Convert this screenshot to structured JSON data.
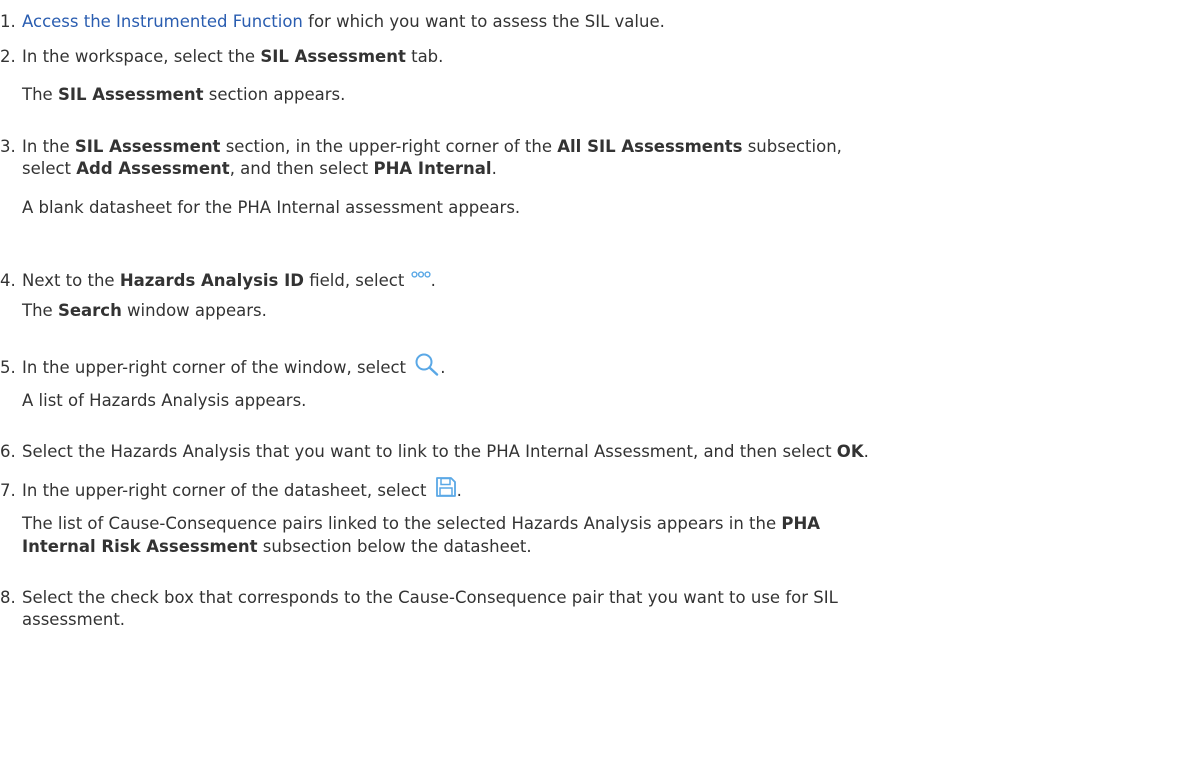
{
  "steps": [
    {
      "num": "1.",
      "text": {
        "link": "Access the Instrumented Function",
        "after": " for which you want to assess the SIL value."
      }
    },
    {
      "num": "2.",
      "text": {
        "before": "In the workspace, select the ",
        "b1": "SIL Assessment",
        "after": " tab."
      },
      "result": {
        "before": "The ",
        "b1": "SIL Assessment",
        "after": " section appears."
      }
    },
    {
      "num": "3.",
      "text": {
        "before": "In the ",
        "b1": "SIL Assessment",
        "mid1": " section, in the upper-right corner of the ",
        "b2": "All SIL Assessments",
        "mid2": " subsection,",
        "l2_before": "select ",
        "b3": "Add Assessment",
        "mid3": ", and then select ",
        "b4": "PHA Internal",
        "after": "."
      },
      "result": {
        "text": "A blank datasheet for the PHA Internal assessment appears."
      }
    },
    {
      "num": "4.",
      "text": {
        "before": "Next to the ",
        "b1": "Hazards Analysis ID",
        "after": " field, select ",
        "icon": "more-options-icon",
        "end": "."
      },
      "result": {
        "before": "The ",
        "b1": "Search",
        "after": " window appears."
      }
    },
    {
      "num": "5.",
      "text": {
        "before": "In the upper-right corner of the window, select ",
        "icon": "search-icon",
        "end": "."
      },
      "result": {
        "text": "A list of Hazards Analysis appears."
      }
    },
    {
      "num": "6.",
      "text": {
        "before": "Select the Hazards Analysis that you want to link to the PHA Internal Assessment, and then select ",
        "b1": "OK",
        "after": "."
      }
    },
    {
      "num": "7.",
      "text": {
        "before": "In the upper-right corner of the datasheet, select ",
        "icon": "save-icon",
        "end": "."
      },
      "result": {
        "before": "The list of Cause-Consequence pairs linked to the selected Hazards Analysis appears in the ",
        "b1": "PHA",
        "b2": "Internal Risk Assessment",
        "after": " subsection below the datasheet."
      }
    },
    {
      "num": "8.",
      "text": {
        "line1": "Select the check box that corresponds to the Cause-Consequence pair that you want to use for SIL",
        "line2": "assessment."
      }
    }
  ],
  "colors": {
    "link": "#2a5db0",
    "text": "#333333",
    "icon": "#5aa8e6"
  }
}
